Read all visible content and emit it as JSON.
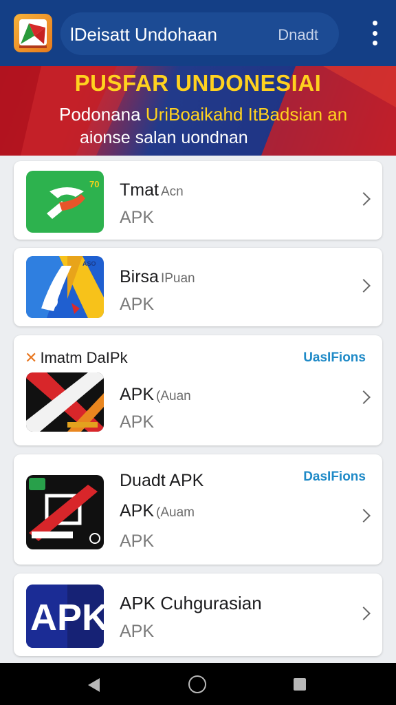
{
  "header": {
    "title": "lDeisatt Undohaan",
    "action_label": "Dnadt",
    "logo_icon": "app-logo-icon",
    "menu_icon": "more-vert-icon"
  },
  "banner": {
    "title": "PUSFAR UNDONESIAI",
    "line1_part1": "Podonana",
    "line1_part2": "UriBoaikahd",
    "line1_part3": "ItBadsian an",
    "line2": "aionse salan uondnan"
  },
  "apps": [
    {
      "name": "Tmat",
      "name_sub": "Acn",
      "type": "APK",
      "icon": "green-arrow-app-icon"
    },
    {
      "name": "Birsa",
      "name_sub": "IPuan",
      "type": "APK",
      "icon": "blue-yellow-a-app-icon"
    },
    {
      "header": "Imatm DaIPk",
      "header_action": "UasIFions",
      "name": "APK",
      "name_sub": "(Auan",
      "type": "APK",
      "icon": "black-red-x-app-icon"
    },
    {
      "name": "Duadt APK",
      "header_action": "DasIFions",
      "name2": "APK",
      "name2_sub": "(Auam",
      "type": "APK",
      "icon": "black-red-slash-app-icon"
    },
    {
      "name": "APK Cuhgurasian",
      "type": "APK",
      "icon": "apk-letters-app-icon",
      "icon_text": "APK"
    }
  ],
  "navbar": {
    "back_icon": "back-triangle-icon",
    "home_icon": "home-circle-icon",
    "recents_icon": "recents-square-icon"
  },
  "colors": {
    "topbar": "#143f86",
    "banner_yellow": "#ffd21f",
    "banner_red": "#c9202b",
    "link_blue": "#1f8ac7"
  }
}
